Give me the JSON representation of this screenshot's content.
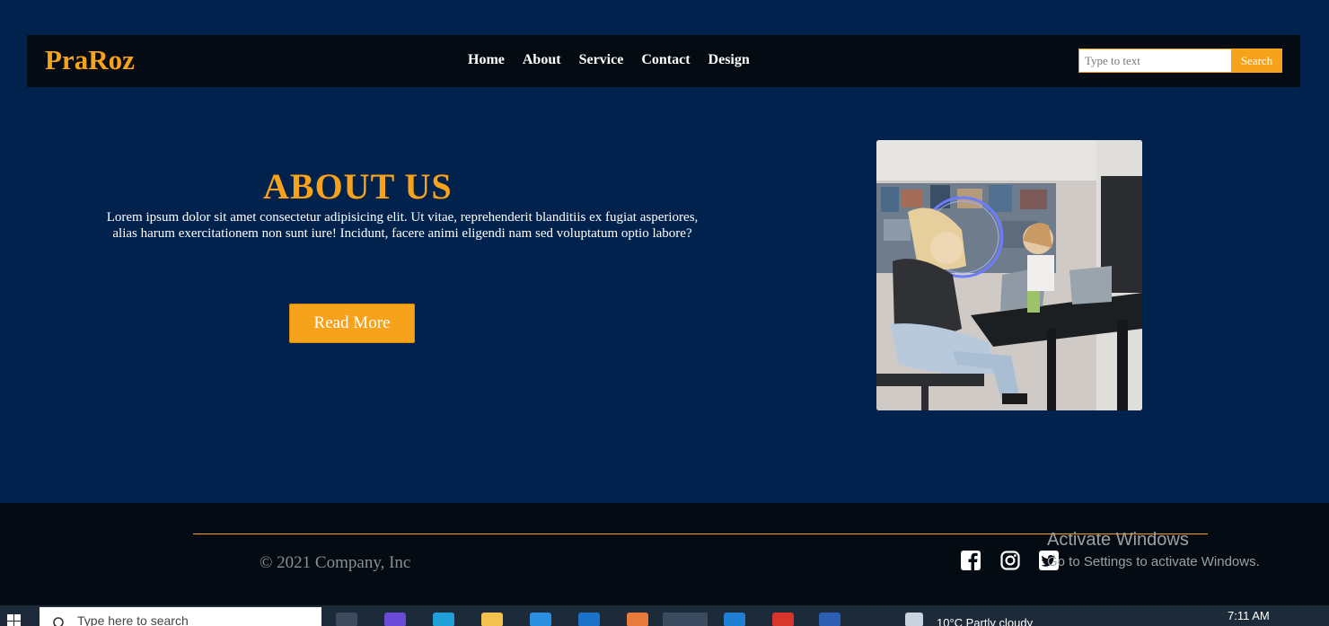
{
  "header": {
    "brand": "PraRoz",
    "nav": [
      "Home",
      "About",
      "Service",
      "Contact",
      "Design"
    ],
    "search": {
      "placeholder": "Type to text",
      "button": "Search"
    }
  },
  "hero": {
    "title": "ABOUT US",
    "text_line1": "Lorem ipsum dolor sit amet consectetur adipisicing elit. Ut vitae, reprehenderit blanditiis ex fugiat asperiores,",
    "text_line2": "alias harum exercitationem non sunt iure! Incidunt, facere animi eligendi nam sed voluptatum optio labore?",
    "button": "Read More",
    "image": "office-team-photo"
  },
  "footer": {
    "copyright": "© 2021 Company, Inc",
    "social": [
      "facebook-icon",
      "instagram-icon",
      "twitter-icon"
    ]
  },
  "watermark": {
    "line1": "Activate Windows",
    "line2": "Go to Settings to activate Windows."
  },
  "taskbar": {
    "search_placeholder": "Type here to search",
    "weather": "10°C  Partly cloudy",
    "time": "7:11 AM"
  },
  "colors": {
    "page_bg": "#00224d",
    "nav_bg": "#050b12",
    "accent": "#f7a21b",
    "footer_bg": "#050b12"
  }
}
